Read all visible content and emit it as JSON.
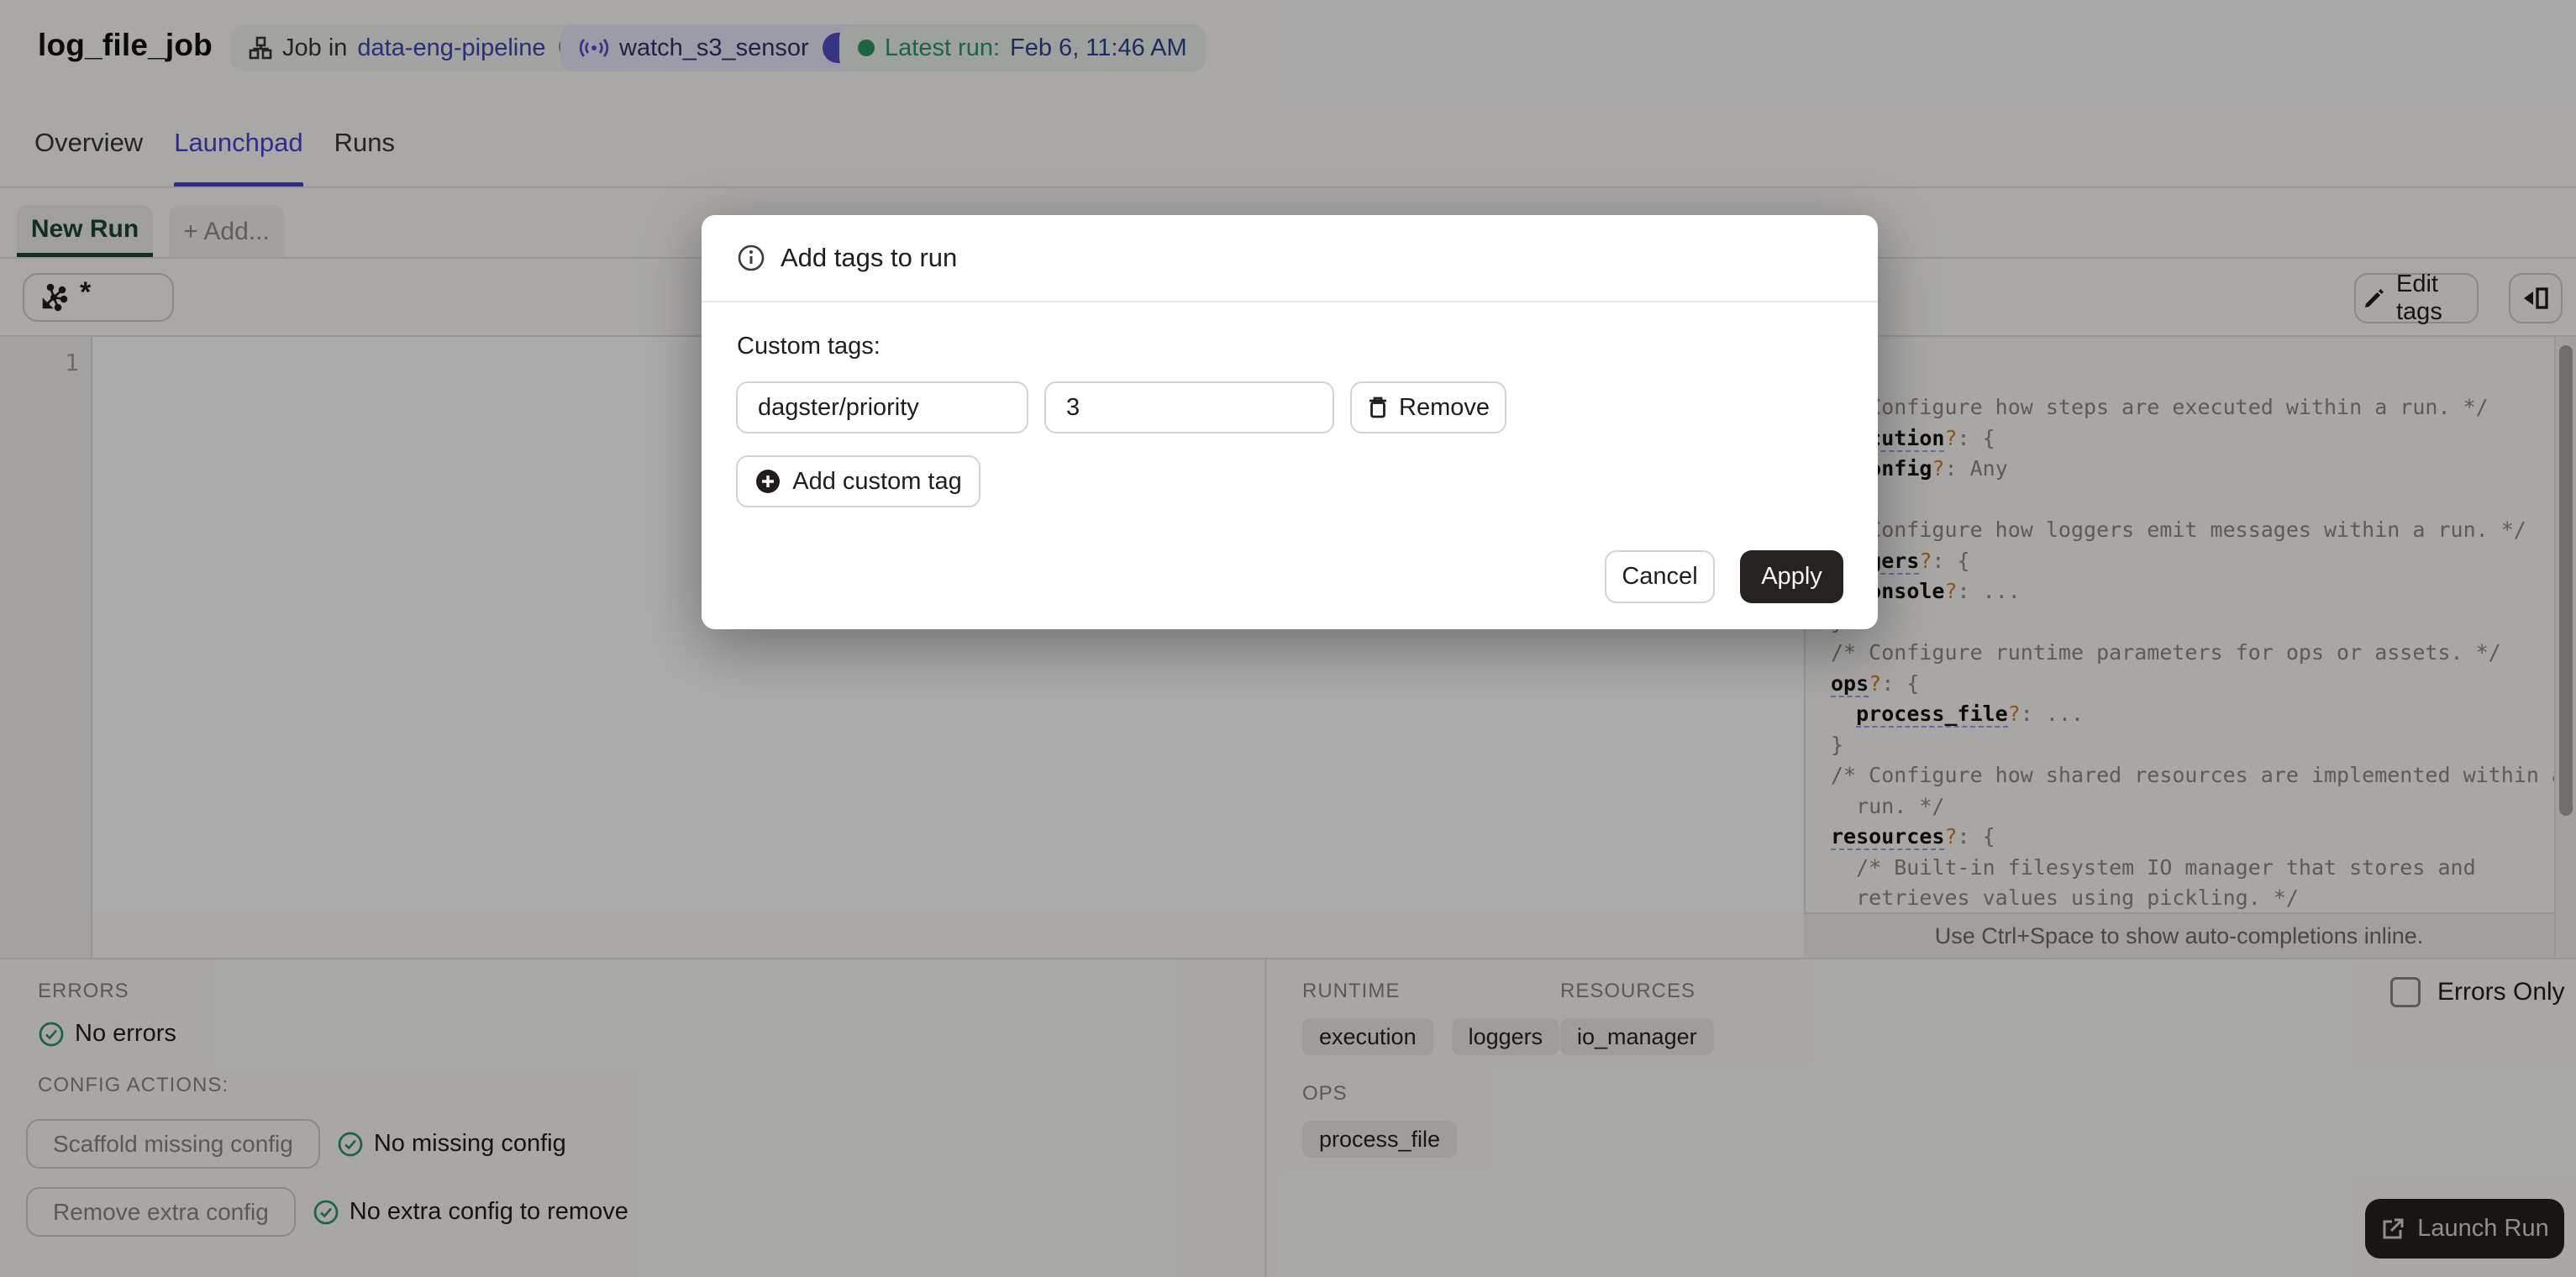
{
  "header": {
    "title": "log_file_job",
    "job_badge": {
      "prefix": "Job in",
      "link": "data-eng-pipeline"
    },
    "sensor_badge": {
      "label": "watch_s3_sensor"
    },
    "latest_run_badge": {
      "label": "Latest run:",
      "value": "Feb 6, 11:46 AM"
    }
  },
  "tabs": [
    {
      "label": "Overview",
      "active": false
    },
    {
      "label": "Launchpad",
      "active": true
    },
    {
      "label": "Runs",
      "active": false
    }
  ],
  "launchpad": {
    "run_tab_label": "New Run",
    "add_tab_label": "+ Add...",
    "op_selector_value": "*",
    "edit_tags_label": "Edit tags",
    "line_number": "1",
    "autocomplete_hint": "Use Ctrl+Space to show auto-completions inline."
  },
  "modal": {
    "title": "Add tags to run",
    "custom_tags_label": "Custom tags:",
    "rows": [
      {
        "key": "dagster/priority",
        "value": "3",
        "remove_label": "Remove"
      }
    ],
    "add_button_label": "Add custom tag",
    "cancel_label": "Cancel",
    "apply_label": "Apply"
  },
  "code_panel": {
    "lines": [
      [
        [
          "/* Configure how steps are executed within a run. */",
          "c"
        ]
      ],
      [
        [
          "execution",
          "ku"
        ],
        [
          "?",
          "q"
        ],
        [
          ":",
          "p"
        ],
        [
          " {",
          "p"
        ]
      ],
      [
        [
          "  ",
          "p"
        ],
        [
          "config",
          "k"
        ],
        [
          "?",
          "q"
        ],
        [
          ":",
          "p"
        ],
        [
          " Any",
          "v"
        ]
      ],
      [
        [
          "}",
          "p"
        ]
      ],
      [
        [
          "/* Configure how loggers emit messages within a run. */",
          "c"
        ]
      ],
      [
        [
          "loggers",
          "ku"
        ],
        [
          "?",
          "q"
        ],
        [
          ":",
          "p"
        ],
        [
          " {",
          "p"
        ]
      ],
      [
        [
          "  ",
          "p"
        ],
        [
          "console",
          "k"
        ],
        [
          "?",
          "q"
        ],
        [
          ":",
          "p"
        ],
        [
          " ...",
          "v"
        ]
      ],
      [
        [
          "}",
          "p"
        ]
      ],
      [
        [
          "/* Configure runtime parameters for ops or assets. */",
          "c"
        ]
      ],
      [
        [
          "ops",
          "ku"
        ],
        [
          "?",
          "q"
        ],
        [
          ":",
          "p"
        ],
        [
          " {",
          "p"
        ]
      ],
      [
        [
          "  ",
          "p"
        ],
        [
          "process_file",
          "ku"
        ],
        [
          "?",
          "q"
        ],
        [
          ":",
          "p"
        ],
        [
          " ...",
          "v"
        ]
      ],
      [
        [
          "}",
          "p"
        ]
      ],
      [
        [
          "/* Configure how shared resources are implemented within a",
          "c"
        ]
      ],
      [
        [
          "  run. */",
          "c"
        ]
      ],
      [
        [
          "resources",
          "ku"
        ],
        [
          "?",
          "q"
        ],
        [
          ":",
          "p"
        ],
        [
          " {",
          "p"
        ]
      ],
      [
        [
          "  /* Built-in filesystem IO manager that stores and",
          "c"
        ]
      ],
      [
        [
          "  retrieves values using pickling. */",
          "c"
        ]
      ]
    ]
  },
  "bottom_left": {
    "errors_label": "ERRORS",
    "no_errors_status": "No errors",
    "config_actions_label": "CONFIG ACTIONS:",
    "actions": [
      {
        "button": "Scaffold missing config",
        "status": "No missing config"
      },
      {
        "button": "Remove extra config",
        "status": "No extra config to remove"
      }
    ]
  },
  "bottom_right": {
    "sections": [
      {
        "label": "RUNTIME",
        "tags": [
          "execution",
          "loggers"
        ]
      },
      {
        "label": "RESOURCES",
        "tags": [
          "io_manager"
        ]
      },
      {
        "label": "OPS",
        "tags": [
          "process_file"
        ]
      }
    ],
    "errors_only_label": "Errors Only",
    "launch_button_label": "Launch Run"
  },
  "colors": {
    "accent_indigo": "#4643D0",
    "link_blue": "#3E46B4",
    "sensor_badge_bg": "#E9E7FB",
    "success_green": "#2E9663",
    "run_tab_green": "#1B4637",
    "dark_button": "#24201F",
    "code_optional_marker": "#C77F27"
  }
}
